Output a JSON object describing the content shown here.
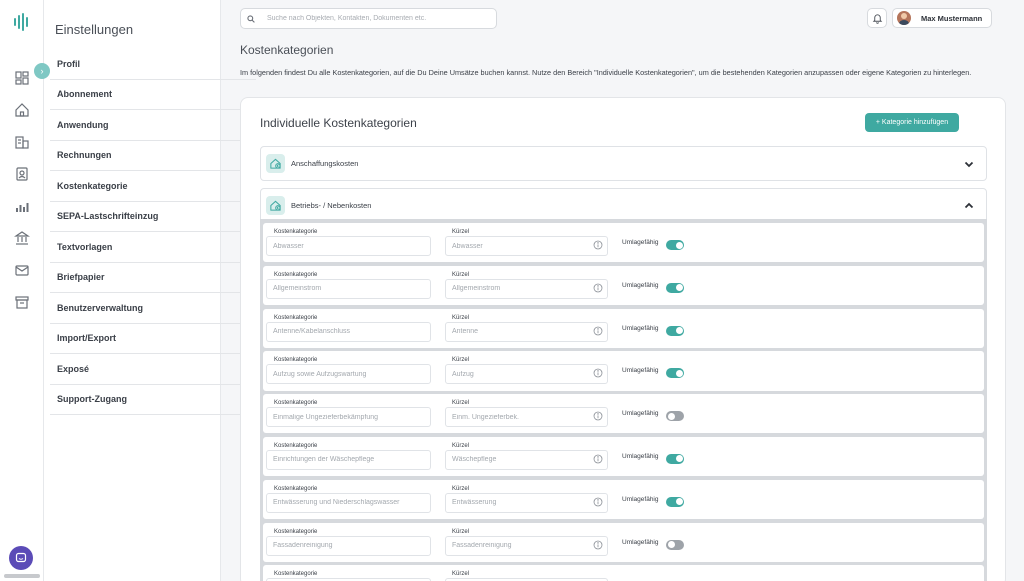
{
  "settings": {
    "title": "Einstellungen",
    "menu": [
      {
        "label": "Profil"
      },
      {
        "label": "Abonnement"
      },
      {
        "label": "Anwendung"
      },
      {
        "label": "Rechnungen"
      },
      {
        "label": "Kostenkategorie"
      },
      {
        "label": "SEPA-Lastschrifteinzug"
      },
      {
        "label": "Textvorlagen"
      },
      {
        "label": "Briefpapier"
      },
      {
        "label": "Benutzerverwaltung"
      },
      {
        "label": "Import/Export"
      },
      {
        "label": "Exposé"
      },
      {
        "label": "Support-Zugang"
      }
    ]
  },
  "topbar": {
    "search_placeholder": "Suche nach Objekten, Kontakten, Dokumenten etc.",
    "user_name": "Max Mustermann"
  },
  "page": {
    "title": "Kostenkategorien",
    "description": "Im folgenden findest Du alle Kostenkategorien, auf die Du Deine Umsätze buchen kannst. Nutze den Bereich \"Individuelle Kostenkategorien\", um die bestehenden Kategorien anzupassen oder eigene Kategorien zu hinterlegen."
  },
  "card": {
    "title": "Individuelle Kostenkategorien",
    "add_button": "+ Kategorie hinzufügen"
  },
  "groups": [
    {
      "label": "Anschaffungskosten",
      "expanded": false
    },
    {
      "label": "Betriebs- / Nebenkosten",
      "expanded": true
    }
  ],
  "field_labels": {
    "category": "Kostenkategorie",
    "short": "Kürzel",
    "toggle": "Umlagefähig"
  },
  "rows": [
    {
      "category": "Abwasser",
      "short": "Abwasser",
      "umlagefaehig": true
    },
    {
      "category": "Allgemeinstrom",
      "short": "Allgemeinstrom",
      "umlagefaehig": true
    },
    {
      "category": "Antenne/Kabelanschluss",
      "short": "Antenne",
      "umlagefaehig": true
    },
    {
      "category": "Aufzug sowie Aufzugswartung",
      "short": "Aufzug",
      "umlagefaehig": true
    },
    {
      "category": "Einmalige Ungezieferbekämpfung",
      "short": "Einm. Ungezieferbek.",
      "umlagefaehig": false
    },
    {
      "category": "Einrichtungen der Wäschepflege",
      "short": "Wäschepflege",
      "umlagefaehig": true
    },
    {
      "category": "Entwässerung und Niederschlagswasser",
      "short": "Entwässerung",
      "umlagefaehig": true
    },
    {
      "category": "Fassadenreinigung",
      "short": "Fassadenreinigung",
      "umlagefaehig": false
    },
    {
      "category": "",
      "short": "",
      "umlagefaehig": null
    }
  ],
  "colors": {
    "accent": "#3fa9a1",
    "toggle_off": "#9ea3a9",
    "chat_button": "#5b4bb7"
  }
}
